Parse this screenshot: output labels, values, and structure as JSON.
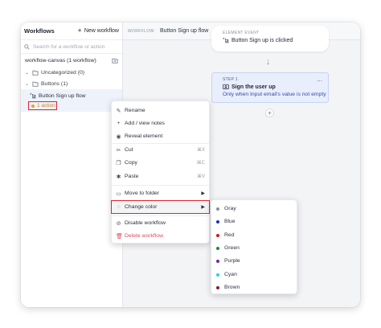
{
  "sidebar": {
    "title": "Workflows",
    "new_workflow_label": "New workflow",
    "search_placeholder": "Search for a workflow or action",
    "canvas_label": "workflow-canvas (1 workflow)",
    "folders": [
      {
        "label": "Uncategorized (0)"
      },
      {
        "label": "Buttons (1)"
      }
    ],
    "workflow": {
      "name": "Button Sign up flow",
      "actions": "1 action",
      "actions_color": "#f0a020"
    }
  },
  "breadcrumb": {
    "label": "WORKFLOW:",
    "value": "Button Sign up flow"
  },
  "event_card": {
    "tag": "ELEMENT EVENT",
    "title": "Button Sign up is clicked"
  },
  "step_card": {
    "tag": "STEP 1",
    "title": "Sign the user up",
    "condition": "Only when Input email's value is not empty",
    "more": "...",
    "add": "+"
  },
  "context_menu": {
    "items": [
      {
        "label": "Rename",
        "icon": "pencil-icon"
      },
      {
        "label": "Add / view notes",
        "icon": "plus-icon"
      },
      {
        "label": "Reveal element",
        "icon": "eye-icon"
      },
      {
        "label": "Cut",
        "icon": "scissors-icon",
        "shortcut": "⌘X"
      },
      {
        "label": "Copy",
        "icon": "copy-icon",
        "shortcut": "⌘C"
      },
      {
        "label": "Paste",
        "icon": "paste-icon",
        "shortcut": "⌘V"
      },
      {
        "label": "Move to folder",
        "icon": "folder-icon"
      },
      {
        "label": "Change color",
        "icon": "palette-icon"
      },
      {
        "label": "Disable workflow",
        "icon": "disable-icon"
      },
      {
        "label": "Delete workflow",
        "icon": "trash-icon"
      }
    ]
  },
  "color_menu": {
    "items": [
      {
        "label": "Gray",
        "color": "#8a8f98"
      },
      {
        "label": "Blue",
        "color": "#1d2fb5"
      },
      {
        "label": "Red",
        "color": "#d11a1a"
      },
      {
        "label": "Green",
        "color": "#1e8a3a"
      },
      {
        "label": "Purple",
        "color": "#7a1fa8"
      },
      {
        "label": "Cyan",
        "color": "#27d3e6"
      },
      {
        "label": "Brown",
        "color": "#8a1a2a"
      }
    ]
  }
}
